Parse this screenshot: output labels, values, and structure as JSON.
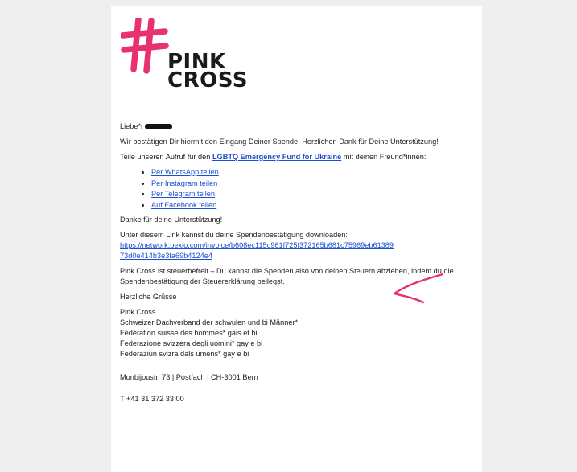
{
  "logo": {
    "line1": "PINK",
    "line2": "CROSS",
    "mark_color": "#e8316f"
  },
  "email": {
    "greeting": "Liebe*r",
    "confirmation": "Wir bestätigen Dir hiermit den Eingang Deiner Spende. Herzlichen Dank für Deine Unterstützung!",
    "share_intro_before": "Teile unseren Aufruf für den",
    "fund_link": "LGBTQ Emergency Fund for Ukraine",
    "share_intro_after": "mit deinen Freund*innen:",
    "share_links": [
      "Per WhatsApp teilen",
      "Per Instagram teilen",
      "Per Telegram teilen",
      "Auf Facebook teilen"
    ],
    "thanks": "Danke für deine Unterstützung!",
    "download_intro": "Unter diesem Link kannst du deine Spendenbestätigung downloaden:",
    "download_url": "https://network.bexio.com/invoice/b608ec115c961f725f372165b681c75969eb6138973d0e414b3e3fa69b4124e4",
    "tax_note": "Pink Cross ist steuerbefreit – Du kannst die Spenden also von deinen Steuern abziehen, indem du die Spendenbestätigung der Steuererklärung beilegst.",
    "closing": "Herzliche Grüsse",
    "signature": [
      "Pink Cross",
      "Schweizer Dachverband der schwulen und bi Männer*",
      "Fédération suisse des hommes* gais et bi",
      "Federazione svizzera degli uomini* gay e bi",
      "Federaziun svizra dals umens* gay e bi"
    ],
    "address": "Monbijoustr. 73 | Postfach | CH-3001 Bern",
    "phone": "T +41 31 372 33 00"
  },
  "annotation": {
    "arrow_color": "#e8316f"
  }
}
